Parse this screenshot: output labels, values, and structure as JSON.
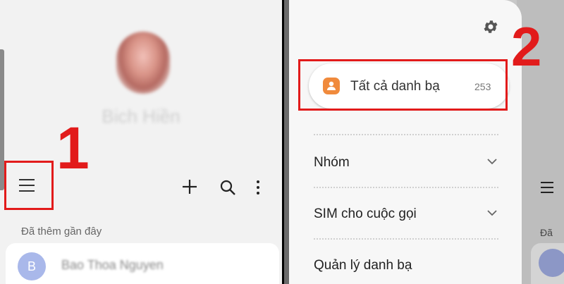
{
  "left_panel": {
    "profile_name": "Bich Hiền",
    "step_number": "1",
    "section_label": "Đã thêm gần đây",
    "contact": {
      "avatar_letter": "B",
      "name": "Bao Thoa Nguyen"
    }
  },
  "right_panel": {
    "step_number": "2",
    "all_contacts": {
      "label": "Tất cả danh bạ",
      "count": "253"
    },
    "menu_items": [
      {
        "label": "Nhóm",
        "expandable": true
      },
      {
        "label": "SIM cho cuộc gọi",
        "expandable": true
      },
      {
        "label": "Quản lý danh bạ",
        "expandable": false
      }
    ],
    "background": {
      "section_label_partial": "Đã",
      "avatar_letter": "B"
    }
  },
  "colors": {
    "highlight": "#e21b1b",
    "contacts_icon": "#f08a3c",
    "avatar": "#a9b8ea"
  },
  "icons": [
    "menu-icon",
    "add-icon",
    "search-icon",
    "more-options-icon",
    "settings-gear-icon",
    "contacts-icon",
    "chevron-down-icon"
  ]
}
